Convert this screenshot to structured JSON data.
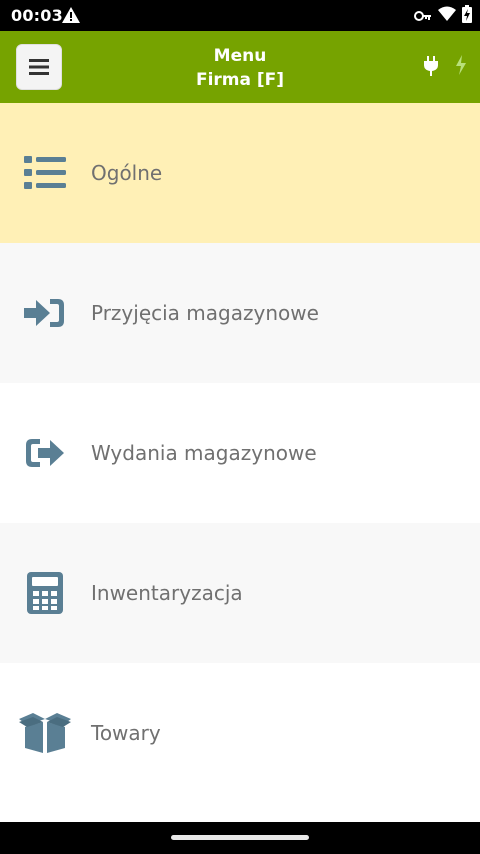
{
  "status_bar": {
    "time": "00:03",
    "icons": [
      "alert-icon",
      "vpn-key-icon",
      "wifi-icon",
      "battery-charging-icon"
    ]
  },
  "app_bar": {
    "background": "#76a300",
    "title": "Menu",
    "subtitle": "Firma [F]",
    "icons": [
      "hamburger-menu-icon",
      "plug-icon",
      "bolt-icon"
    ]
  },
  "menu": {
    "items": [
      {
        "label": "Ogólne",
        "icon": "list-icon",
        "active": true
      },
      {
        "label": "Przyjęcia magazynowe",
        "icon": "sign-in-arrow-icon",
        "active": false
      },
      {
        "label": "Wydania magazynowe",
        "icon": "sign-out-arrow-icon",
        "active": false
      },
      {
        "label": "Inwentaryzacja",
        "icon": "calculator-icon",
        "active": false
      },
      {
        "label": "Towary",
        "icon": "open-box-icon",
        "active": false
      }
    ],
    "icon_color": "#5a7f94",
    "active_color": "#fff0b6"
  }
}
